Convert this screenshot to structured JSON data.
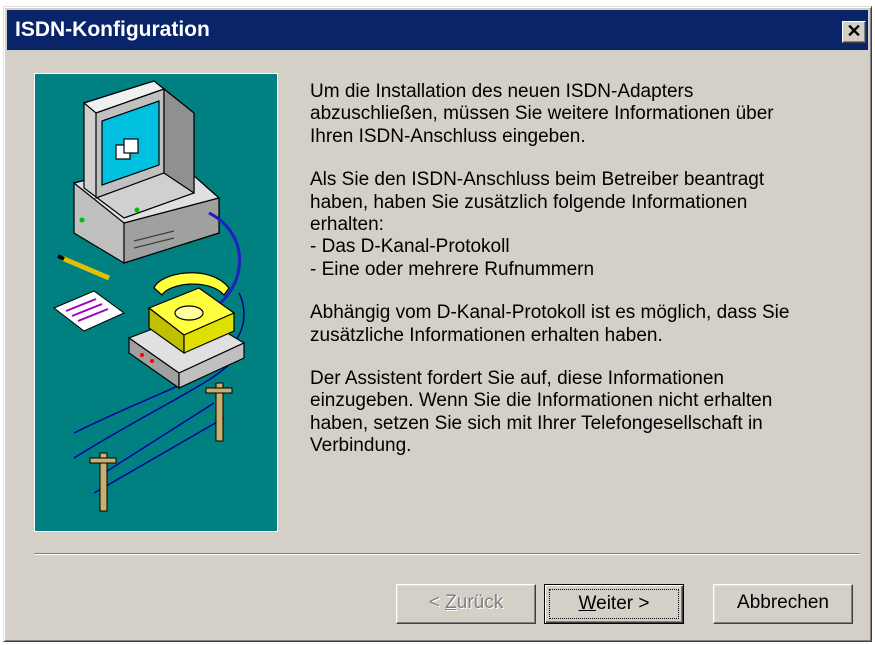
{
  "window": {
    "title": "ISDN-Konfiguration",
    "close_symbol": "✕"
  },
  "content": {
    "intro_lines": [
      "Um die Installation des neuen ISDN-Adapters",
      "abzuschließen, müssen Sie weitere Informationen über",
      "Ihren ISDN-Anschluss eingeben."
    ],
    "info_lines": [
      "Als Sie den ISDN-Anschluss beim Betreiber beantragt",
      "haben, haben Sie zusätzlich folgende Informationen",
      "erhalten:",
      "- Das D-Kanal-Protokoll",
      "- Eine oder mehrere Rufnummern"
    ],
    "dkanal_lines": [
      "Abhängig vom D-Kanal-Protokoll ist es möglich, dass Sie",
      "zusätzliche Informationen erhalten haben."
    ],
    "assistant_lines": [
      "Der Assistent fordert Sie auf, diese Informationen",
      "einzugeben. Wenn Sie die Informationen nicht erhalten",
      "haben, setzen Sie sich mit Ihrer Telefongesellschaft in",
      "Verbindung."
    ]
  },
  "buttons": {
    "back_prefix": "< ",
    "back_accel": "Z",
    "back_rest": "urück",
    "next_accel": "W",
    "next_rest": "eiter >",
    "cancel": "Abbrechen"
  },
  "colors": {
    "titlebar": "#0a246a",
    "dialog_bg": "#d4d0c8",
    "illustration_bg": "#008080"
  },
  "icons": [
    "close-icon",
    "computer-telephone-illustration"
  ]
}
